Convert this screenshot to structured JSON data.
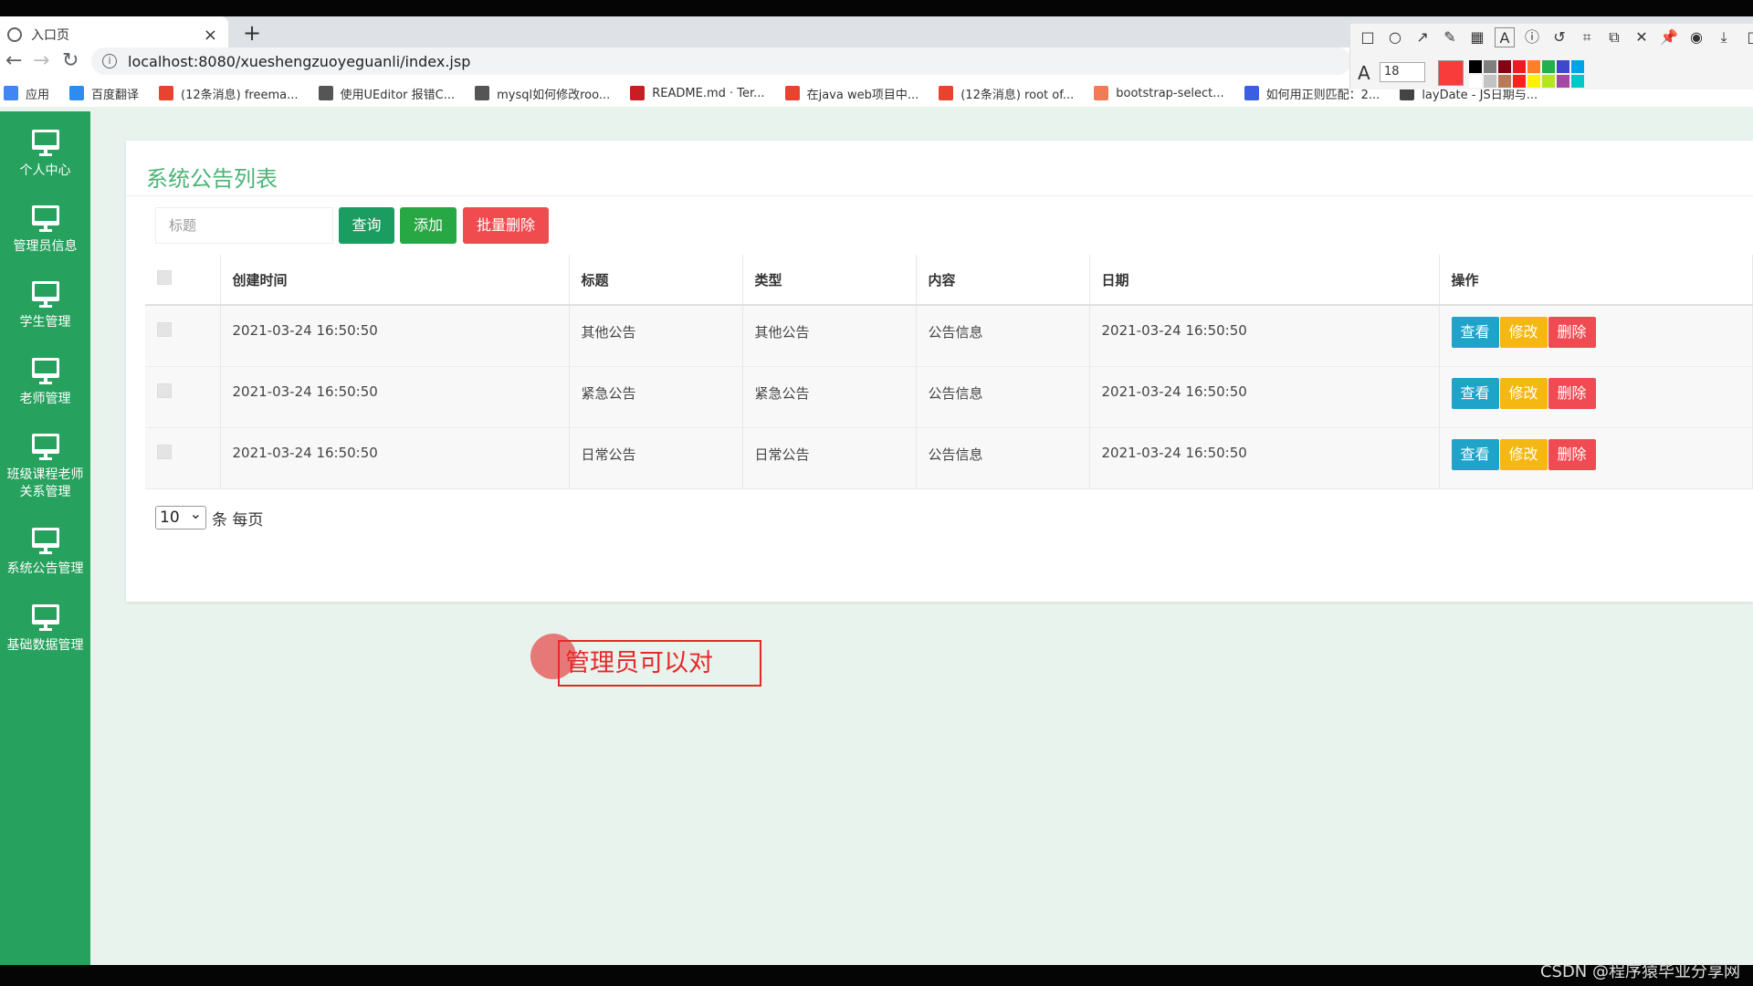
{
  "browser": {
    "tab_title": "入口页",
    "tab_close": "×",
    "new_tab": "+",
    "url": "localhost:8080/xueshengzuoyeguanli/index.jsp",
    "bookmarks": [
      {
        "label": "应用",
        "color": "#4285f4",
        "icon": "apps-icon"
      },
      {
        "label": "百度翻译",
        "color": "#2d8cf0",
        "icon": "baidu-translate-icon"
      },
      {
        "label": "(12条消息) freema...",
        "color": "#e8432f",
        "icon": "csdn-icon"
      },
      {
        "label": "使用UEditor 报错C...",
        "color": "#555555",
        "icon": "ueditor-icon"
      },
      {
        "label": "mysql如何修改roo...",
        "color": "#555555",
        "icon": "mysql-icon"
      },
      {
        "label": "README.md · Ter...",
        "color": "#c71d23",
        "icon": "gitee-icon"
      },
      {
        "label": "在java web项目中...",
        "color": "#e8432f",
        "icon": "csdn-icon"
      },
      {
        "label": "(12条消息) root of...",
        "color": "#e8432f",
        "icon": "csdn-icon"
      },
      {
        "label": "bootstrap-select...",
        "color": "#f07b54",
        "icon": "jianshu-icon"
      },
      {
        "label": "如何用正则匹配：2...",
        "color": "#3b5fe0",
        "icon": "baidu-icon"
      },
      {
        "label": "layDate - JS日期与...",
        "color": "#444444",
        "icon": "layui-icon"
      }
    ]
  },
  "drawbar": {
    "font_size": "18",
    "font_icon": "A",
    "current_color": "#f83b3b",
    "palette": [
      "#000000",
      "#7f7f7f",
      "#880015",
      "#ed1c24",
      "#ff7f27",
      "#22b14c",
      "#3f48cc",
      "#00a2e8",
      "#ffffff",
      "#c3c3c3",
      "#b97a57",
      "#ff2020",
      "#fff200",
      "#b5e61d",
      "#a349a4",
      "#00c8c8"
    ]
  },
  "sidebar": {
    "items": [
      {
        "label": "个人中心"
      },
      {
        "label": "管理员信息"
      },
      {
        "label": "学生管理"
      },
      {
        "label": "老师管理"
      },
      {
        "label": "班级课程老师关系管理"
      },
      {
        "label": "系统公告管理"
      },
      {
        "label": "基础数据管理"
      }
    ]
  },
  "main": {
    "title": "系统公告列表",
    "search": {
      "placeholder": "标题"
    },
    "buttons": {
      "query": "查询",
      "add": "添加",
      "batch_delete": "批量删除"
    },
    "table": {
      "headers": [
        "创建时间",
        "标题",
        "类型",
        "内容",
        "日期",
        "操作"
      ],
      "rows": [
        {
          "created": "2021-03-24 16:50:50",
          "title": "其他公告",
          "type": "其他公告",
          "content": "公告信息",
          "date": "2021-03-24 16:50:50"
        },
        {
          "created": "2021-03-24 16:50:50",
          "title": "紧急公告",
          "type": "紧急公告",
          "content": "公告信息",
          "date": "2021-03-24 16:50:50"
        },
        {
          "created": "2021-03-24 16:50:50",
          "title": "日常公告",
          "type": "日常公告",
          "content": "公告信息",
          "date": "2021-03-24 16:50:50"
        }
      ],
      "ops": {
        "view": "查看",
        "edit": "修改",
        "delete": "删除"
      }
    },
    "pager": {
      "page_size": "10",
      "suffix": "条 每页"
    }
  },
  "annotation": {
    "text": "管理员可以对"
  },
  "watermark": "CSDN @程序猿毕业分享网"
}
